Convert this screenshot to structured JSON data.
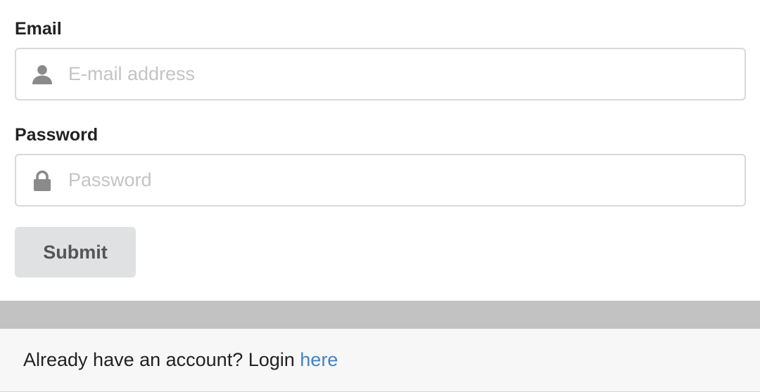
{
  "form": {
    "email": {
      "label": "Email",
      "placeholder": "E-mail address",
      "icon": "user-icon",
      "value": ""
    },
    "password": {
      "label": "Password",
      "placeholder": "Password",
      "icon": "lock-icon",
      "value": ""
    },
    "submit_label": "Submit"
  },
  "footer": {
    "prefix_text": "Already have an account? Login ",
    "link_text": "here"
  },
  "colors": {
    "link": "#4183c4",
    "button_bg": "#e0e1e2",
    "divider": "#c2c2c2",
    "footer_bg": "#f7f7f7"
  }
}
